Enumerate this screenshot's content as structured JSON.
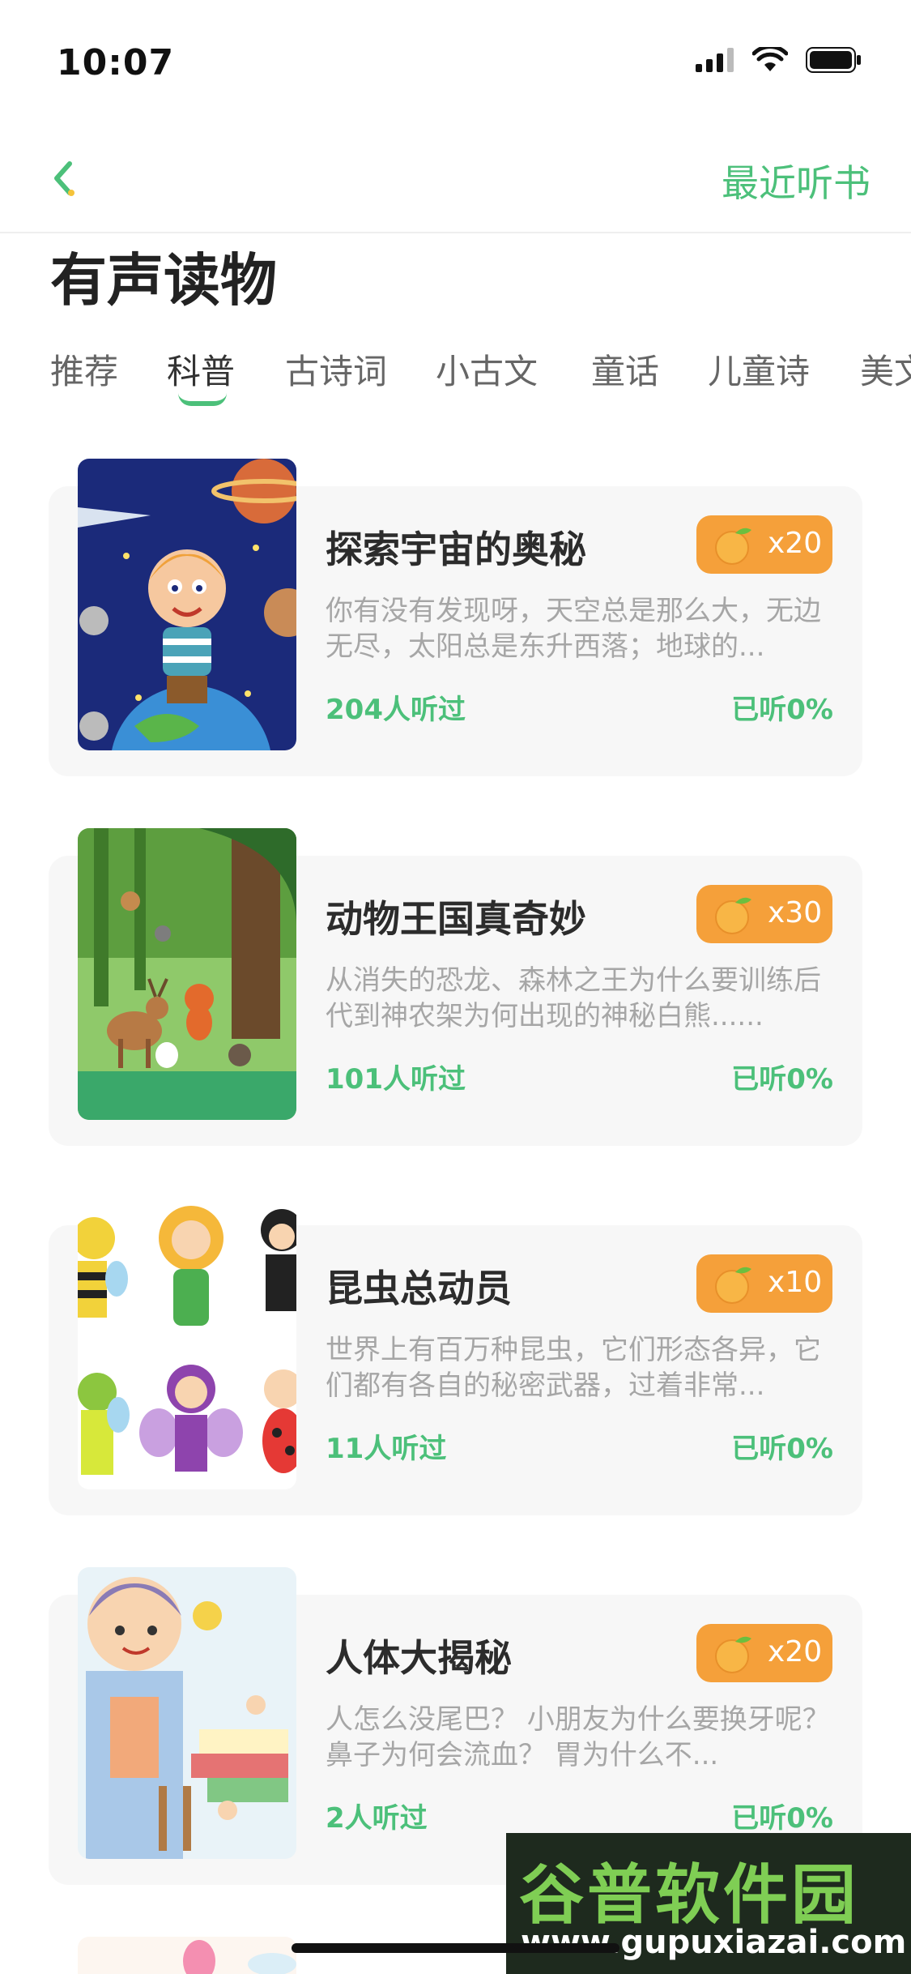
{
  "status": {
    "time": "10:07"
  },
  "nav": {
    "recent_label": "最近听书"
  },
  "page": {
    "title": "有声读物"
  },
  "tabs": [
    "推荐",
    "科普",
    "古诗词",
    "小古文",
    "童话",
    "儿童诗",
    "美文"
  ],
  "active_tab": "科普",
  "books": [
    {
      "title": "探索宇宙的奥秘",
      "price": "x20",
      "desc": "你有没有发现呀，天空总是那么大，无边无尽，太阳总是东升西落；地球的...",
      "listeners": "204人听过",
      "progress": "已听0%"
    },
    {
      "title": "动物王国真奇妙",
      "price": "x30",
      "desc": "从消失的恐龙、森林之王为什么要训练后代到神农架为何出现的神秘白熊......",
      "listeners": "101人听过",
      "progress": "已听0%"
    },
    {
      "title": "昆虫总动员",
      "price": "x10",
      "desc": "世界上有百万种昆虫，它们形态各异，它们都有各自的秘密武器，过着非常...",
      "listeners": "11人听过",
      "progress": "已听0%"
    },
    {
      "title": "人体大揭秘",
      "price": "x20",
      "desc": "人怎么没尾巴？ 小朋友为什么要换牙呢？ 鼻子为何会流血？ 胃为什么不...",
      "listeners": "2人听过",
      "progress": "已听0%"
    }
  ],
  "watermark": {
    "title": "谷普软件园",
    "url": "www.gupuxiazai.com"
  },
  "colors": {
    "accent": "#4cc07a",
    "badge": "#f5a03a"
  }
}
